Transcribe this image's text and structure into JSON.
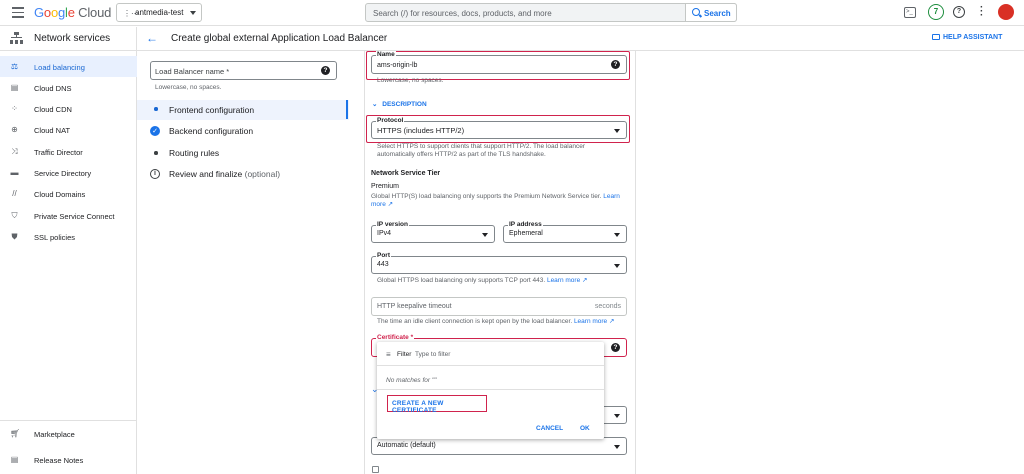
{
  "topbar": {
    "logo": "Google Cloud",
    "project": "antmedia-test",
    "search_placeholder": "Search (/) for resources, docs, products, and more",
    "search_button": "Search",
    "notifications_count": "7"
  },
  "sidebar": {
    "title": "Network services",
    "items": [
      {
        "label": "Load balancing",
        "icon": "load-balancing-icon",
        "active": true
      },
      {
        "label": "Cloud DNS",
        "icon": "dns-icon"
      },
      {
        "label": "Cloud CDN",
        "icon": "cdn-icon"
      },
      {
        "label": "Cloud NAT",
        "icon": "nat-icon"
      },
      {
        "label": "Traffic Director",
        "icon": "traffic-director-icon"
      },
      {
        "label": "Service Directory",
        "icon": "service-directory-icon"
      },
      {
        "label": "Cloud Domains",
        "icon": "domains-icon"
      },
      {
        "label": "Private Service Connect",
        "icon": "private-service-connect-icon"
      },
      {
        "label": "SSL policies",
        "icon": "ssl-policies-icon"
      }
    ],
    "footer": [
      {
        "label": "Marketplace",
        "icon": "marketplace-icon"
      },
      {
        "label": "Release Notes",
        "icon": "release-notes-icon"
      }
    ]
  },
  "header": {
    "title": "Create global external Application Load Balancer",
    "help_assistant": "HELP ASSISTANT"
  },
  "steps": {
    "lb_name_placeholder": "Load Balancer name *",
    "lb_name_hint": "Lowercase, no spaces.",
    "items": [
      {
        "label": "Frontend configuration",
        "state": "current"
      },
      {
        "label": "Backend configuration",
        "state": "done"
      },
      {
        "label": "Routing rules",
        "state": "pending"
      },
      {
        "label": "Review and finalize",
        "suffix": "(optional)",
        "state": "info"
      }
    ]
  },
  "form": {
    "name_label": "Name",
    "name_value": "ams-origin-lb",
    "name_hint": "Lowercase, no spaces.",
    "description_toggle": "DESCRIPTION",
    "protocol_label": "Protocol",
    "protocol_value": "HTTPS (includes HTTP/2)",
    "protocol_hint_1": "Select HTTPS to support clients that support HTTP/2. The load balancer",
    "protocol_hint_2": "automatically offers HTTP/2 as part of the TLS handshake.",
    "tier_heading": "Network Service Tier",
    "tier_value": "Premium",
    "tier_desc": "Global HTTP(S) load balancing only supports the Premium Network Service tier.",
    "learn_more": "Learn",
    "more": "more",
    "ip_version_label": "IP version",
    "ip_version_value": "IPv4",
    "ip_address_label": "IP address",
    "ip_address_value": "Ephemeral",
    "port_label": "Port",
    "port_value": "443",
    "port_hint": "Global HTTPS load balancing only supports TCP port 443.",
    "port_learn_more": "Learn more",
    "keepalive_placeholder": "HTTP keepalive timeout",
    "keepalive_unit": "seconds",
    "keepalive_hint": "The time an idle client connection is kept open by the load balancer.",
    "keepalive_learn_more": "Learn more",
    "certificate_label": "Certificate *",
    "hidden_select_value": "Automatic (default)"
  },
  "popup": {
    "filter_label": "Filter",
    "filter_placeholder": "Type to filter",
    "no_matches": "No matches for \"\"",
    "create_button": "CREATE A NEW CERTIFICATE",
    "cancel_button": "CANCEL",
    "ok_button": "OK"
  },
  "colors": {
    "accent": "#1a73e8",
    "highlight_border": "#d0234d",
    "active_bg": "#e8f0fe"
  }
}
